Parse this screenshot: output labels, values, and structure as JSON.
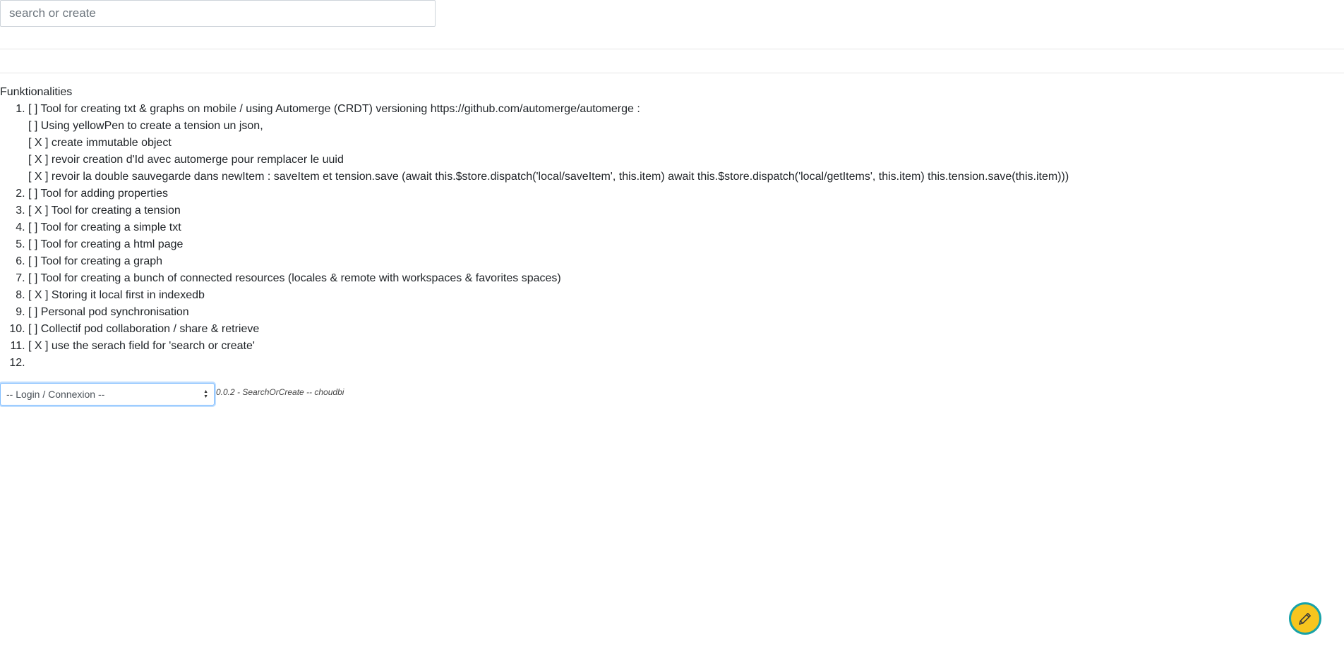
{
  "search": {
    "placeholder": "search or create",
    "value": ""
  },
  "content": {
    "heading": "Funktionalities",
    "items": [
      {
        "text": "[ ] Tool for creating txt & graphs on mobile / using Automerge (CRDT) versioning https://github.com/automerge/automerge :",
        "sub": [
          "[ ] Using yellowPen to create a tension un json,",
          "[ X ] create immutable object",
          "[ X ] revoir creation d'Id avec automerge pour remplacer le uuid",
          "[ X ] revoir la double sauvegarde dans newItem : saveItem et tension.save (await this.$store.dispatch('local/saveItem', this.item) await this.$store.dispatch('local/getItems', this.item) this.tension.save(this.item)))"
        ]
      },
      {
        "text": "[ ] Tool for adding properties"
      },
      {
        "text": "[ X ] Tool for creating a tension"
      },
      {
        "text": "[ ] Tool for creating a simple txt"
      },
      {
        "text": "[ ] Tool for creating a html page"
      },
      {
        "text": "[ ] Tool for creating a graph"
      },
      {
        "text": "[ ] Tool for creating a bunch of connected resources (locales & remote with workspaces & favorites spaces)"
      },
      {
        "text": "[ X ] Storing it local first in indexedb"
      },
      {
        "text": "[ ] Personal pod synchronisation"
      },
      {
        "text": "[ ] Collectif pod collaboration / share & retrieve"
      },
      {
        "text": "[ X ] use the serach field for 'search or create'"
      },
      {
        "text": ""
      }
    ]
  },
  "footer": {
    "login_select": {
      "selected": "-- Login / Connexion --"
    },
    "version": "0.0.2 - SearchOrCreate -- choudbi"
  },
  "icons": {
    "fab": "pencil-icon",
    "select": "select-arrows-icon"
  },
  "colors": {
    "fab_fill": "#f7c51e",
    "fab_border": "#17a2a8",
    "select_focus": "#80bdff"
  }
}
